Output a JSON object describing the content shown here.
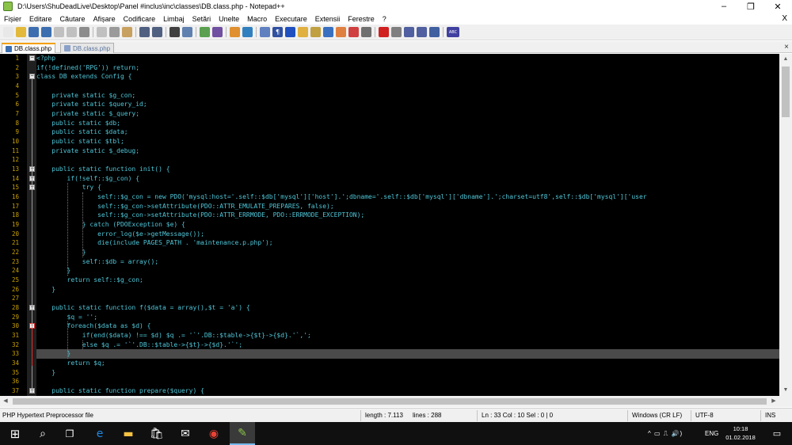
{
  "window": {
    "title": "D:\\Users\\ShuDeadLive\\Desktop\\Panel #inclus\\inc\\classes\\DB.class.php - Notepad++",
    "minimize": "–",
    "maximize": "❐",
    "close": "✕"
  },
  "menu": {
    "items": [
      "Fișier",
      "Editare",
      "Căutare",
      "Afișare",
      "Codificare",
      "Limbaj",
      "Setări",
      "Unelte",
      "Macro",
      "Executare",
      "Extensii",
      "Ferestre",
      "?"
    ],
    "close": "X"
  },
  "toolbar": {
    "icons": [
      {
        "name": "new-file-icon",
        "color": "#e8e8e8",
        "glyph": ""
      },
      {
        "name": "open-file-icon",
        "color": "#e2b93b",
        "glyph": ""
      },
      {
        "name": "save-icon",
        "color": "#3d6fb0",
        "glyph": ""
      },
      {
        "name": "save-all-icon",
        "color": "#3d6fb0",
        "glyph": ""
      },
      {
        "name": "close-icon",
        "color": "#c0c0c0",
        "glyph": ""
      },
      {
        "name": "close-all-icon",
        "color": "#c0c0c0",
        "glyph": ""
      },
      {
        "name": "print-icon",
        "color": "#8c8c8c",
        "glyph": ""
      },
      {
        "sep": true
      },
      {
        "name": "cut-icon",
        "color": "#c0c0c0",
        "glyph": ""
      },
      {
        "name": "copy-icon",
        "color": "#9a9a9a",
        "glyph": ""
      },
      {
        "name": "paste-icon",
        "color": "#c8a060",
        "glyph": ""
      },
      {
        "sep": true
      },
      {
        "name": "undo-icon",
        "color": "#506080",
        "glyph": ""
      },
      {
        "name": "redo-icon",
        "color": "#506080",
        "glyph": ""
      },
      {
        "sep": true
      },
      {
        "name": "find-icon",
        "color": "#404040",
        "glyph": ""
      },
      {
        "name": "replace-icon",
        "color": "#6080b0",
        "glyph": ""
      },
      {
        "sep": true
      },
      {
        "name": "zoom-in-icon",
        "color": "#5aa050",
        "glyph": ""
      },
      {
        "name": "zoom-out-icon",
        "color": "#7050a0",
        "glyph": ""
      },
      {
        "sep": true
      },
      {
        "name": "sync-v-icon",
        "color": "#e09030",
        "glyph": ""
      },
      {
        "name": "sync-h-icon",
        "color": "#3080c0",
        "glyph": ""
      },
      {
        "sep": true
      },
      {
        "name": "word-wrap-icon",
        "color": "#6080c0",
        "glyph": ""
      },
      {
        "name": "show-all-chars-icon",
        "color": "#3050a0",
        "glyph": "¶"
      },
      {
        "name": "indent-guide-icon",
        "color": "#2050c0",
        "glyph": ""
      },
      {
        "name": "udl-icon",
        "color": "#e0b040",
        "glyph": ""
      },
      {
        "name": "doc-map-icon",
        "color": "#c0a040",
        "glyph": ""
      },
      {
        "name": "function-list-icon",
        "color": "#3a70c0",
        "glyph": ""
      },
      {
        "name": "folder-workspace-icon",
        "color": "#e08040",
        "glyph": ""
      },
      {
        "name": "monitor-icon",
        "color": "#d04040",
        "glyph": ""
      },
      {
        "name": "eye-icon",
        "color": "#707070",
        "glyph": ""
      },
      {
        "sep": true
      },
      {
        "name": "record-macro-icon",
        "color": "#d02020",
        "glyph": ""
      },
      {
        "name": "stop-macro-icon",
        "color": "#808080",
        "glyph": ""
      },
      {
        "name": "play-macro-icon",
        "color": "#5060a0",
        "glyph": ""
      },
      {
        "name": "play-multiple-icon",
        "color": "#5060a0",
        "glyph": ""
      },
      {
        "name": "save-macro-icon",
        "color": "#4060a0",
        "glyph": ""
      },
      {
        "sep": true
      },
      {
        "name": "spell-check-icon",
        "color": "#4040a0",
        "glyph": "ABC"
      }
    ]
  },
  "tabs": [
    {
      "label": "DB.class.php",
      "active": true,
      "disk_color": "#3d6fb0"
    },
    {
      "label": "DB.class.php",
      "active": false,
      "disk_color": "#8aa0c8"
    }
  ],
  "tab_close": "×",
  "editor": {
    "lines": [
      {
        "n": "1",
        "code": "<?php",
        "fold": "box"
      },
      {
        "n": "2",
        "code": "if(!defined('RPG')) return;"
      },
      {
        "n": "3",
        "code": "class DB extends Config {",
        "fold": "box"
      },
      {
        "n": "4",
        "code": ""
      },
      {
        "n": "5",
        "code": "    private static $g_con;"
      },
      {
        "n": "6",
        "code": "    private static $query_id;"
      },
      {
        "n": "7",
        "code": "    private static $_query;"
      },
      {
        "n": "8",
        "code": "    public static $db;"
      },
      {
        "n": "9",
        "code": "    public static $data;"
      },
      {
        "n": "10",
        "code": "    public static $tbl;"
      },
      {
        "n": "11",
        "code": "    private static $_debug;"
      },
      {
        "n": "12",
        "code": ""
      },
      {
        "n": "13",
        "code": "    public static function init() {",
        "fold": "box"
      },
      {
        "n": "14",
        "code": "        if(!self::$g_con) {",
        "fold": "box"
      },
      {
        "n": "15",
        "code": "            try {",
        "fold": "box"
      },
      {
        "n": "16",
        "code": "                self::$g_con = new PDO('mysql:host='.self::$db['mysql']['host'].';dbname='.self::$db['mysql']['dbname'].';charset=utf8',self::$db['mysql']['user"
      },
      {
        "n": "17",
        "code": "                self::$g_con->setAttribute(PDO::ATTR_EMULATE_PREPARES, false);"
      },
      {
        "n": "18",
        "code": "                self::$g_con->setAttribute(PDO::ATTR_ERRMODE, PDO::ERRMODE_EXCEPTION);"
      },
      {
        "n": "19",
        "code": "            } catch (PDOException $e) {"
      },
      {
        "n": "20",
        "code": "                error_log($e->getMessage());"
      },
      {
        "n": "21",
        "code": "                die(include PAGES_PATH . 'maintenance.p.php');"
      },
      {
        "n": "22",
        "code": "            }"
      },
      {
        "n": "23",
        "code": "            self::$db = array();"
      },
      {
        "n": "24",
        "code": "        }"
      },
      {
        "n": "25",
        "code": "        return self::$g_con;"
      },
      {
        "n": "26",
        "code": "    }"
      },
      {
        "n": "27",
        "code": ""
      },
      {
        "n": "28",
        "code": "    public static function f($data = array(),$t = 'a') {",
        "fold": "box"
      },
      {
        "n": "29",
        "code": "        $q = '';"
      },
      {
        "n": "30",
        "code": "        foreach($data as $d) {",
        "fold": "red"
      },
      {
        "n": "31",
        "code": "            if(end($data) !== $d) $q .= '`'.DB::$table->{$t}->{$d}.'`,';"
      },
      {
        "n": "32",
        "code": "            else $q .= '`'.DB::$table->{$t}->{$d}.'`';"
      },
      {
        "n": "33",
        "code": "        }",
        "current": true
      },
      {
        "n": "34",
        "code": "        return $q;"
      },
      {
        "n": "35",
        "code": "    }"
      },
      {
        "n": "36",
        "code": ""
      },
      {
        "n": "37",
        "code": "    public static function prepare($query) {",
        "fold": "box"
      }
    ]
  },
  "status": {
    "language": "PHP Hypertext Preprocessor file",
    "length": "length : 7.113",
    "lines": "lines : 288",
    "position": "Ln : 33    Col : 10    Sel : 0 | 0",
    "eol": "Windows (CR LF)",
    "encoding": "UTF-8",
    "mode": "INS"
  },
  "taskbar": {
    "start": "⊞",
    "search": "⌕",
    "taskview": "❐",
    "apps": [
      {
        "name": "edge-icon",
        "glyph": "e",
        "color": "#1e88e5"
      },
      {
        "name": "file-explorer-icon",
        "glyph": "▬",
        "color": "#f5c342"
      },
      {
        "name": "store-icon",
        "glyph": "🛍",
        "color": "#ffffff"
      },
      {
        "name": "mail-icon",
        "glyph": "✉",
        "color": "#ffffff"
      },
      {
        "name": "chrome-icon",
        "glyph": "◉",
        "color": "#e94235"
      },
      {
        "name": "notepadpp-icon",
        "glyph": "✎",
        "color": "#8bc34a"
      }
    ],
    "tray_icons": "^  ▭  ⎍  🔊)",
    "language": "ENG",
    "time": "10:18",
    "date": "01.02.2018",
    "notifications": "▭"
  }
}
